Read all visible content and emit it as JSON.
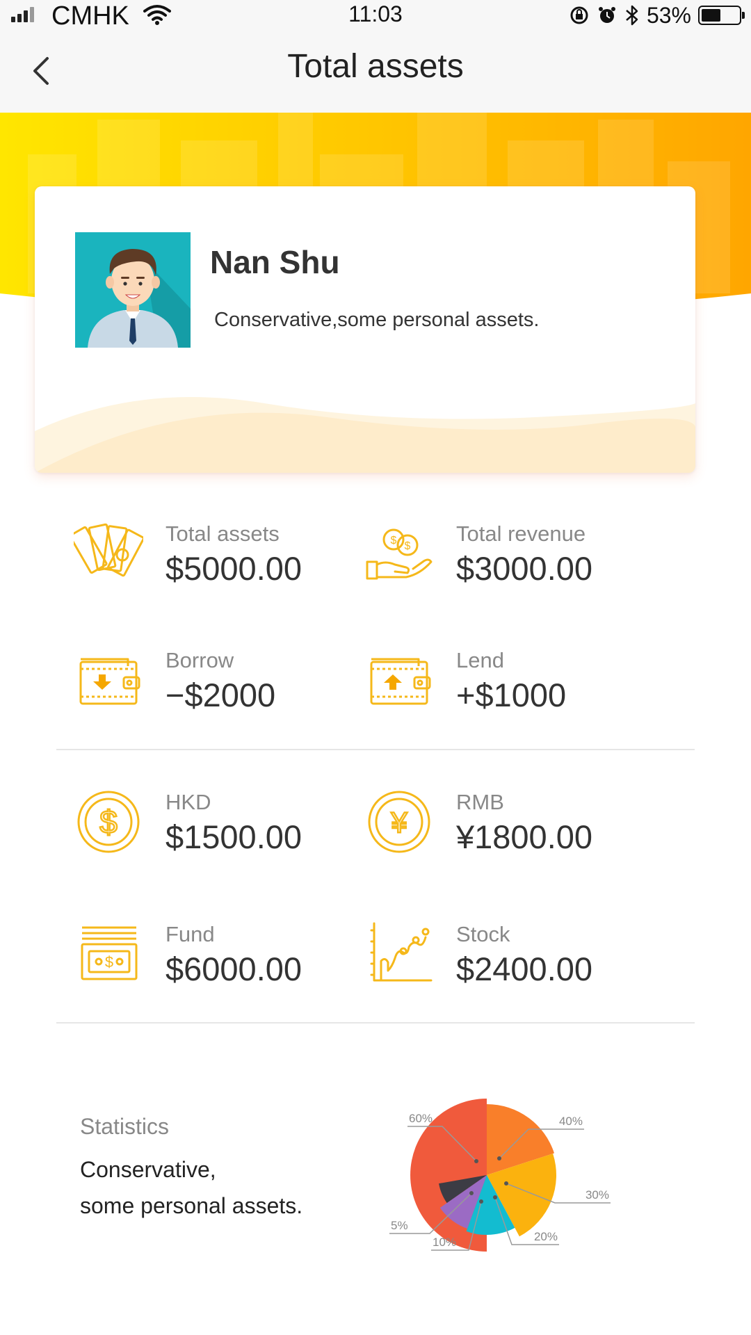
{
  "status_bar": {
    "carrier": "CMHK",
    "time": "11:03",
    "battery": "53%",
    "battery_level": 0.53
  },
  "nav": {
    "title": "Total assets"
  },
  "profile": {
    "name": "Nan Shu",
    "description": "Conservative,some personal assets."
  },
  "stats": [
    {
      "label": "Total assets",
      "value": "$5000.00",
      "icon": "cash-fan-icon"
    },
    {
      "label": "Total revenue",
      "value": "$3000.00",
      "icon": "coins-hand-icon"
    },
    {
      "label": "Borrow",
      "value": "−$2000",
      "icon": "wallet-down-icon"
    },
    {
      "label": "Lend",
      "value": "+$1000",
      "icon": "wallet-up-icon"
    },
    {
      "label": "HKD",
      "value": "$1500.00",
      "icon": "dollar-coin-icon"
    },
    {
      "label": "RMB",
      "value": "¥1800.00",
      "icon": "yuan-coin-icon"
    },
    {
      "label": "Fund",
      "value": "$6000.00",
      "icon": "banknote-stack-icon"
    },
    {
      "label": "Stock",
      "value": "$2400.00",
      "icon": "stock-chart-icon"
    }
  ],
  "statistics": {
    "title": "Statistics",
    "line1": "Conservative,",
    "line2": "some personal assets."
  },
  "colors": {
    "accent": "#f5b400",
    "icon": "#f5b81a",
    "banner_from": "#ffe800",
    "banner_to": "#ffa800"
  },
  "chart_data": {
    "type": "pie",
    "title": "",
    "labels": [
      "60%",
      "40%",
      "30%",
      "20%",
      "10%",
      "5%"
    ],
    "values": [
      60,
      40,
      30,
      20,
      10,
      5
    ],
    "colors": [
      "#f05a3c",
      "#f97f2a",
      "#fbb20e",
      "#13bcd0",
      "#9b6bc4",
      "#3c3c44"
    ]
  }
}
